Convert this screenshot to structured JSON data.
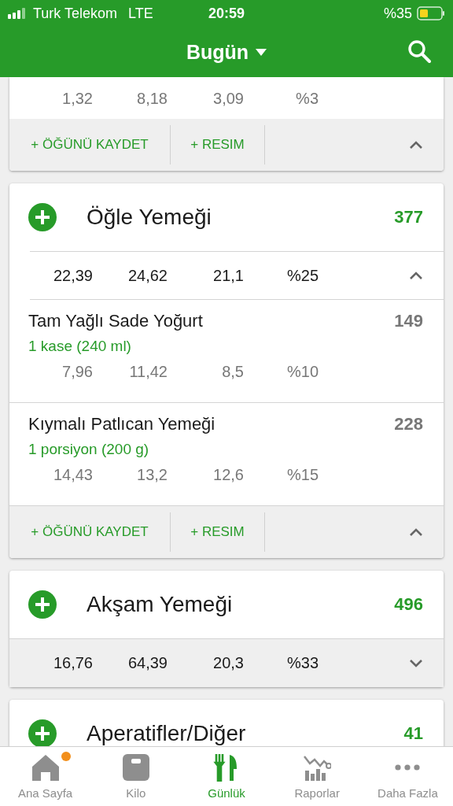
{
  "status_bar": {
    "carrier": "Turk Telekom",
    "network": "LTE",
    "time": "20:59",
    "battery": "%35"
  },
  "header": {
    "title": "Bugün"
  },
  "meals": [
    {
      "expanded": true,
      "items": [
        {
          "macros": [
            "1,32",
            "8,18",
            "3,09",
            "%3"
          ]
        }
      ],
      "actions": [
        "+ ÖĞÜNÜ KAYDET",
        "+ RESIM"
      ]
    },
    {
      "name": "Öğle Yemeği",
      "calories": "377",
      "expanded": true,
      "totals": [
        "22,39",
        "24,62",
        "21,1",
        "%25"
      ],
      "items": [
        {
          "name": "Tam Yağlı Sade Yoğurt",
          "portion": "1 kase (240 ml)",
          "calories": "149",
          "macros": [
            "7,96",
            "11,42",
            "8,5",
            "%10"
          ]
        },
        {
          "name": "Kıymalı Patlıcan Yemeği",
          "portion": "1 porsiyon (200 g)",
          "calories": "228",
          "macros": [
            "14,43",
            "13,2",
            "12,6",
            "%15"
          ]
        }
      ],
      "actions": [
        "+ ÖĞÜNÜ KAYDET",
        "+ RESIM"
      ]
    },
    {
      "name": "Akşam Yemeği",
      "calories": "496",
      "expanded": false,
      "totals": [
        "16,76",
        "64,39",
        "20,3",
        "%33"
      ]
    },
    {
      "name": "Aperatifler/Diğer",
      "calories": "41"
    }
  ],
  "tabs": [
    {
      "label": "Ana Sayfa",
      "selected": false,
      "badge": true
    },
    {
      "label": "Kilo",
      "selected": false,
      "badge": false
    },
    {
      "label": "Günlük",
      "selected": true,
      "badge": false
    },
    {
      "label": "Raporlar",
      "selected": false,
      "badge": false
    },
    {
      "label": "Daha Fazla",
      "selected": false,
      "badge": false
    }
  ]
}
